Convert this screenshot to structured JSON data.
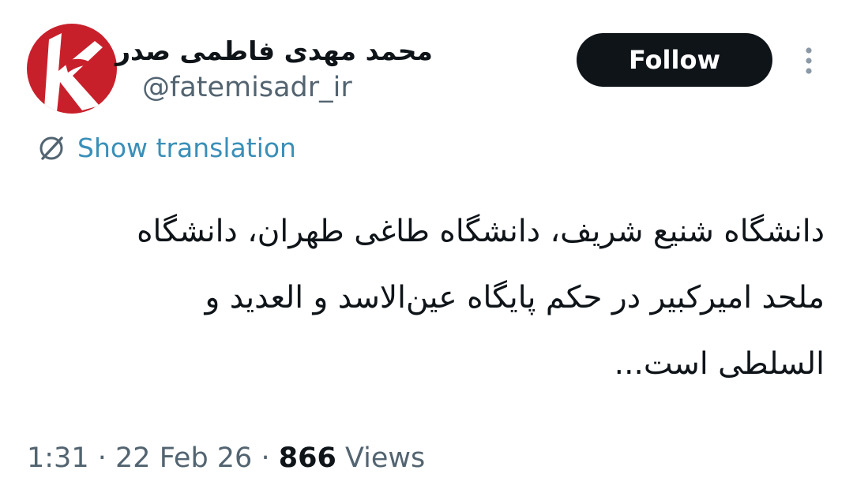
{
  "author": {
    "display_name": "محمد مهدی فاطمی صدر",
    "handle": "@fatemisadr_ir"
  },
  "actions": {
    "follow_label": "Follow",
    "more_icon": "more-vertical-icon"
  },
  "translation": {
    "icon": "globe-icon",
    "label": "Show translation"
  },
  "tweet": {
    "lines": [
      "دانشگاه شنیع شریف، دانشگاه طاغی طهران، دانشگاه",
      "ملحد امیرکبیر در حکم پایگاه عین‌الاسد و العدید و",
      "السلطی است..."
    ]
  },
  "meta": {
    "time": "1:31",
    "separator": "·",
    "date": "22 Feb 26",
    "views_count": "866",
    "views_label": "Views"
  },
  "colors": {
    "button_bg": "#0f1419",
    "link": "#3a8fb8",
    "secondary_text": "#536471",
    "avatar_red": "#c8202b"
  }
}
